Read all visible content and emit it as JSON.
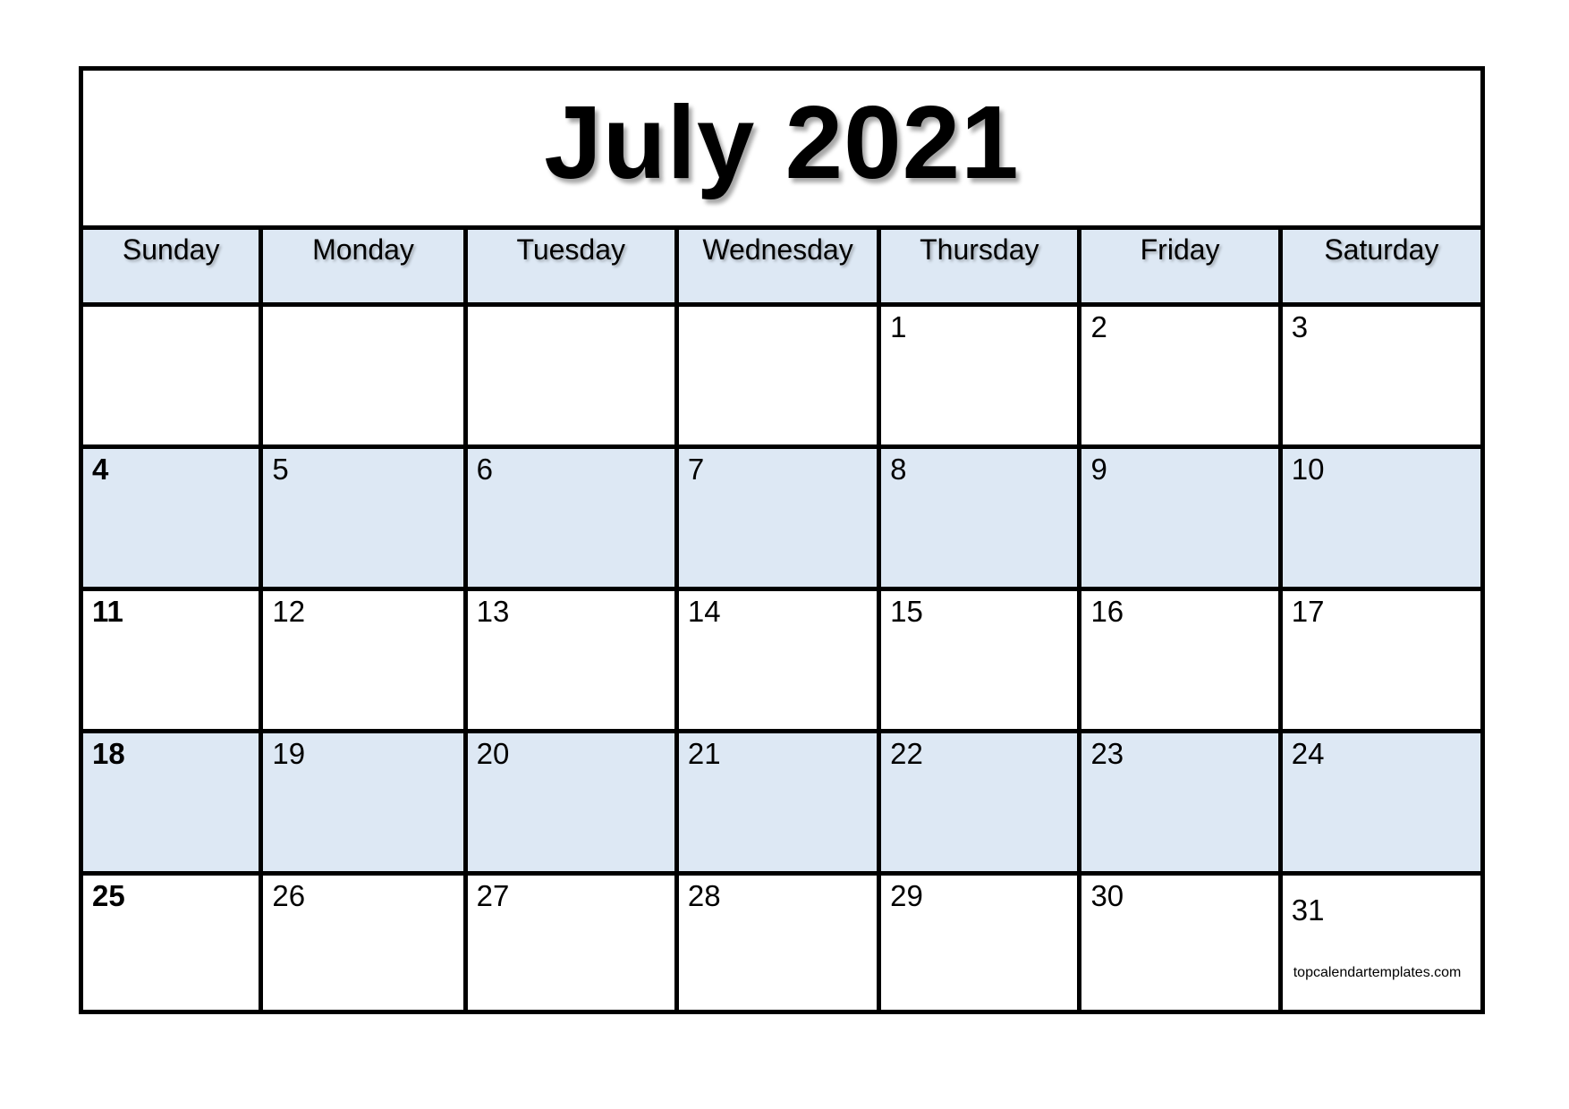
{
  "calendar": {
    "title": "July 2021",
    "weekdays": [
      "Sunday",
      "Monday",
      "Tuesday",
      "Wednesday",
      "Thursday",
      "Friday",
      "Saturday"
    ],
    "weeks": [
      [
        "",
        "",
        "",
        "",
        "1",
        "2",
        "3"
      ],
      [
        "4",
        "5",
        "6",
        "7",
        "8",
        "9",
        "10"
      ],
      [
        "11",
        "12",
        "13",
        "14",
        "15",
        "16",
        "17"
      ],
      [
        "18",
        "19",
        "20",
        "21",
        "22",
        "23",
        "24"
      ],
      [
        "25",
        "26",
        "27",
        "28",
        "29",
        "30",
        "31"
      ]
    ],
    "shaded_weeks": [
      1,
      3
    ],
    "watermark": "topcalendartemplates.com",
    "colors": {
      "header_bg": "#dde8f4",
      "shaded_row_bg": "#dde8f4",
      "border": "#000000"
    }
  }
}
